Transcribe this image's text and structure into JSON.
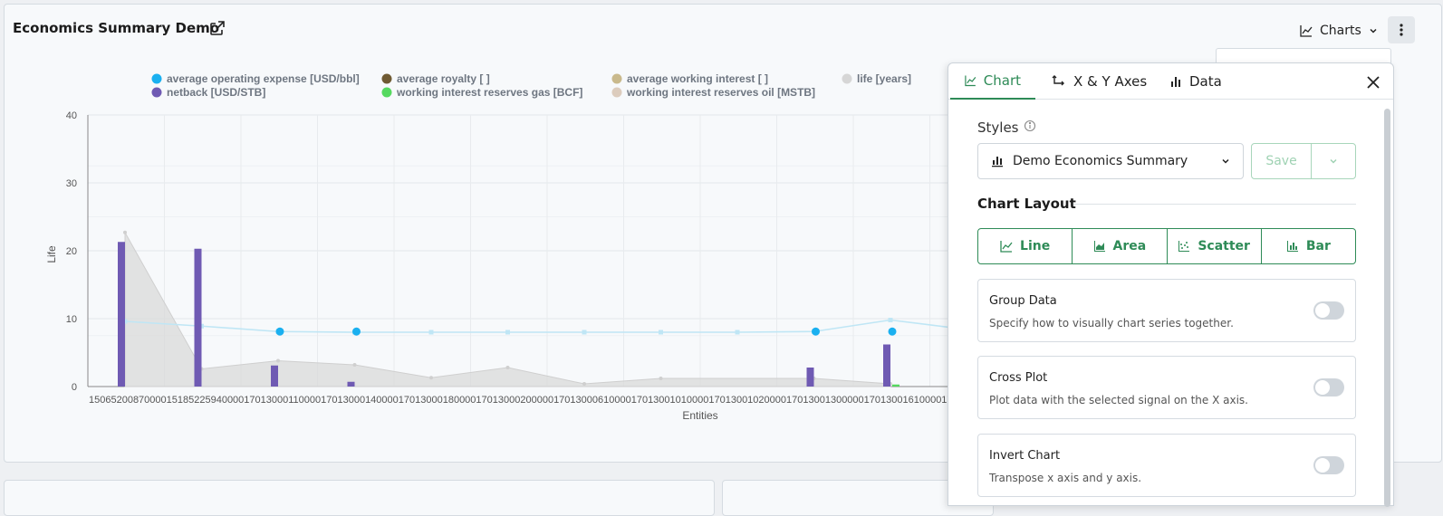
{
  "card": {
    "title": "Economics Summary Demo"
  },
  "header": {
    "charts_label": "Charts"
  },
  "legend": [
    {
      "label": "average operating expense [USD/bbl]",
      "color": "#1ab0f0"
    },
    {
      "label": "average royalty [ ]",
      "color": "#6f5a33"
    },
    {
      "label": "average working interest [ ]",
      "color": "#c9b98c"
    },
    {
      "label": "life [years]",
      "color": "#d6d6d6"
    },
    {
      "label": "netback [USD/STB]",
      "color": "#6f5ab3"
    },
    {
      "label": "working interest reserves gas [BCF]",
      "color": "#55d95f"
    },
    {
      "label": "working interest reserves oil [MSTB]",
      "color": "#dcccbd"
    }
  ],
  "chart_data": {
    "type": "bar",
    "xlabel": "Entities",
    "ylabel": "Life",
    "ylim": [
      0,
      40
    ],
    "yticks": [
      0,
      10,
      20,
      30,
      40
    ],
    "categories": [
      "15065200870000",
      "15185225940000",
      "17013000110000",
      "17013000140000",
      "17013000180000",
      "17013000200000",
      "17013000610000",
      "17013001010000",
      "17013001020000",
      "17013001300000",
      "17013001610000",
      "1701"
    ],
    "x_tick_text": "150652008700001518522594000017013000110000170130001400001701300018000017013000200000170130006100001701300101000017013001020000170130013000001701300161000017013",
    "series": [
      {
        "name": "life [years]",
        "kind": "area",
        "color": "#d9d9d9",
        "values": [
          22.7,
          2.6,
          3.8,
          3.2,
          1.3,
          2.8,
          0.4,
          1.2,
          null,
          1.2,
          0.4,
          null
        ]
      },
      {
        "name": "average operating expense [USD/bbl]",
        "kind": "line",
        "color": "#bfe6f5",
        "values": [
          9.6,
          8.9,
          8.1,
          8.0,
          8.0,
          8.0,
          8.0,
          8.0,
          8.0,
          8.1,
          9.8,
          8.4
        ]
      },
      {
        "name": "netback [USD/STB]",
        "kind": "bar",
        "color": "#6f5ab3",
        "values": [
          21.3,
          20.3,
          3.1,
          0.7,
          null,
          null,
          null,
          null,
          null,
          2.8,
          6.2,
          null
        ]
      },
      {
        "name": "working interest reserves gas [BCF]",
        "kind": "bar",
        "color": "#55d95f",
        "values": [
          null,
          null,
          null,
          null,
          null,
          null,
          null,
          null,
          null,
          null,
          0.3,
          null
        ]
      },
      {
        "name": "markers",
        "kind": "dots",
        "color": "#1ab0f0",
        "values": [
          null,
          null,
          8.1,
          8.1,
          null,
          null,
          null,
          null,
          null,
          8.1,
          8.1,
          null
        ]
      }
    ]
  },
  "panel": {
    "tabs": [
      {
        "label": "Chart"
      },
      {
        "label": "X & Y Axes"
      },
      {
        "label": "Data"
      }
    ],
    "styles_label": "Styles",
    "style_selected": "Demo Economics Summary",
    "save_label": "Save",
    "layout_title": "Chart Layout",
    "layout_options": [
      {
        "label": "Line"
      },
      {
        "label": "Area"
      },
      {
        "label": "Scatter"
      },
      {
        "label": "Bar"
      }
    ],
    "options": [
      {
        "title": "Group Data",
        "desc": "Specify how to visually chart series together."
      },
      {
        "title": "Cross Plot",
        "desc": "Plot data with the selected signal on the X axis."
      },
      {
        "title": "Invert Chart",
        "desc": "Transpose x axis and y axis."
      }
    ],
    "accent": "#2e8b57"
  }
}
